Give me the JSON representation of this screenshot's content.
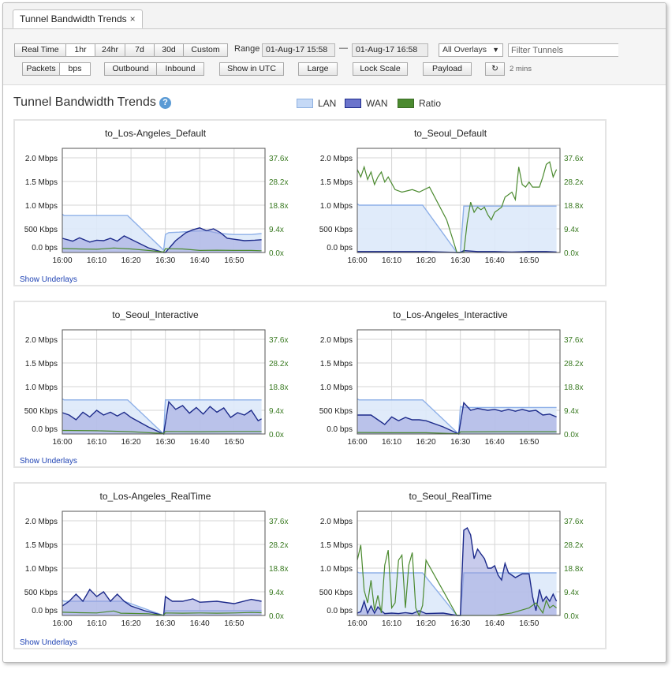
{
  "tab": {
    "title": "Tunnel Bandwidth Trends",
    "close": "×"
  },
  "toolbar": {
    "time_buttons": [
      "Real Time",
      "1hr",
      "24hr",
      "7d",
      "30d",
      "Custom"
    ],
    "active_time": "1hr",
    "range_label": "Range",
    "range_start": "01-Aug-17 15:58",
    "range_sep": "—",
    "range_end": "01-Aug-17 16:58",
    "overlay_select": "All Overlays",
    "filter_placeholder": "Filter Tunnels",
    "unit_buttons": [
      "Packets",
      "bps"
    ],
    "active_unit": "bps",
    "direction_buttons": [
      "Outbound",
      "Inbound"
    ],
    "utc_button": "Show in UTC",
    "large_button": "Large",
    "lockscale_button": "Lock Scale",
    "payload_button": "Payload",
    "refresh_icon": "refresh-icon",
    "refresh_glyph": "↻",
    "refresh_interval": "2 mins"
  },
  "page": {
    "title": "Tunnel Bandwidth Trends",
    "help_glyph": "?",
    "legend": [
      {
        "label": "LAN",
        "color": "#c5d9f6",
        "border": "#8eb0e0"
      },
      {
        "label": "WAN",
        "color": "#6b74cc",
        "border": "#1c2a8a"
      },
      {
        "label": "Ratio",
        "color": "#4b8a2f",
        "border": "#3a6b24"
      }
    ],
    "show_underlays": "Show Underlays"
  },
  "chart_axes": {
    "y_ticks": [
      "2.0 Mbps",
      "1.5 Mbps",
      "1.0 Mbps",
      "500 Kbps",
      "0.0 bps"
    ],
    "y_values_mbps": [
      2.0,
      1.5,
      1.0,
      0.5,
      0.0
    ],
    "y2_ticks": [
      "37.6x",
      "28.2x",
      "18.8x",
      "9.4x",
      "0.0x"
    ],
    "x_ticks": [
      "16:00",
      "16:10",
      "16:20",
      "16:30",
      "16:40",
      "16:50"
    ],
    "x_minutes": [
      0,
      10,
      20,
      30,
      40,
      50
    ]
  },
  "chart_data": [
    {
      "type": "area",
      "title": "to_Los-Angeles_Default",
      "ylim": [
        0,
        2.2
      ],
      "y2lim": [
        0,
        41.4
      ],
      "xlim": [
        0,
        59
      ],
      "series": [
        {
          "name": "LAN",
          "x": [
            0,
            0.5,
            19,
            29.5,
            30,
            31,
            34,
            38,
            42,
            46,
            50,
            55,
            58
          ],
          "y": [
            0.81,
            0.78,
            0.78,
            0.05,
            0.38,
            0.42,
            0.43,
            0.45,
            0.46,
            0.4,
            0.38,
            0.38,
            0.4
          ]
        },
        {
          "name": "WAN",
          "x": [
            0,
            3,
            5,
            8,
            10,
            12,
            14,
            16,
            18,
            20,
            25,
            29.5,
            30,
            33,
            36,
            38,
            40,
            42,
            44,
            46,
            48,
            50,
            53,
            56,
            58
          ],
          "y": [
            0.3,
            0.24,
            0.31,
            0.22,
            0.26,
            0.25,
            0.3,
            0.24,
            0.35,
            0.28,
            0.1,
            0.0,
            0.0,
            0.25,
            0.42,
            0.48,
            0.52,
            0.46,
            0.5,
            0.42,
            0.3,
            0.28,
            0.25,
            0.26,
            0.27
          ]
        },
        {
          "name": "Ratio",
          "x": [
            0,
            5,
            10,
            15,
            20,
            25,
            29.5,
            30,
            35,
            40,
            45,
            50,
            55,
            58
          ],
          "y": [
            1.6,
            1.4,
            1.3,
            1.8,
            1.4,
            0.8,
            0.2,
            1.5,
            1.4,
            0.8,
            0.9,
            0.8,
            0.8,
            0.7
          ]
        }
      ]
    },
    {
      "type": "area",
      "title": "to_Seoul_Default",
      "ylim": [
        0,
        2.2
      ],
      "y2lim": [
        0,
        41.4
      ],
      "xlim": [
        0,
        59
      ],
      "series": [
        {
          "name": "LAN",
          "x": [
            0,
            0.5,
            19,
            29,
            30,
            31,
            58
          ],
          "y": [
            1.03,
            1.0,
            1.0,
            0.0,
            0.0,
            0.98,
            0.98
          ]
        },
        {
          "name": "WAN",
          "x": [
            0,
            10,
            20,
            29,
            30,
            31,
            35,
            40,
            45,
            50,
            55,
            58
          ],
          "y": [
            0.02,
            0.02,
            0.02,
            0.0,
            0.0,
            0.04,
            0.02,
            0.02,
            0.01,
            0.02,
            0.02,
            0.01
          ]
        },
        {
          "name": "Ratio",
          "x": [
            0,
            1,
            2,
            3,
            4,
            5,
            6,
            7,
            8,
            9,
            11,
            13,
            16,
            18,
            21,
            26,
            29,
            30,
            31,
            32,
            33,
            34,
            35,
            36,
            37,
            38,
            39,
            40,
            41,
            42,
            43,
            45,
            46,
            47,
            48,
            49,
            50,
            51,
            53,
            54,
            55,
            56,
            57,
            58
          ],
          "y": [
            33,
            30,
            34,
            29,
            32,
            27,
            30,
            32,
            28,
            30,
            25,
            24,
            25,
            24,
            26,
            13,
            0,
            0,
            0,
            12,
            20,
            16,
            18,
            17,
            18,
            15,
            13,
            16,
            17,
            18,
            22,
            24,
            21,
            34,
            27,
            26,
            28,
            26,
            26,
            30,
            35,
            36,
            30,
            33
          ]
        }
      ]
    },
    {
      "type": "area",
      "title": "to_Seoul_Interactive",
      "ylim": [
        0,
        2.2
      ],
      "y2lim": [
        0,
        41.4
      ],
      "xlim": [
        0,
        59
      ],
      "series": [
        {
          "name": "LAN",
          "x": [
            0,
            0.5,
            19,
            29.5,
            30,
            58
          ],
          "y": [
            0.74,
            0.72,
            0.72,
            0.0,
            0.72,
            0.72
          ]
        },
        {
          "name": "WAN",
          "x": [
            0,
            2,
            4,
            6,
            8,
            10,
            12,
            14,
            16,
            18,
            20,
            25,
            29.5,
            31,
            33,
            35,
            37,
            39,
            41,
            43,
            45,
            47,
            49,
            51,
            53,
            55,
            57,
            58
          ],
          "y": [
            0.45,
            0.4,
            0.3,
            0.46,
            0.36,
            0.5,
            0.4,
            0.46,
            0.38,
            0.46,
            0.35,
            0.15,
            0.0,
            0.68,
            0.52,
            0.6,
            0.44,
            0.56,
            0.42,
            0.58,
            0.46,
            0.55,
            0.35,
            0.45,
            0.4,
            0.5,
            0.28,
            0.32
          ]
        },
        {
          "name": "Ratio",
          "x": [
            0,
            10,
            20,
            29.5,
            30,
            40,
            50,
            58
          ],
          "y": [
            1.4,
            1.3,
            0.9,
            0.2,
            1.0,
            0.9,
            1.0,
            1.0
          ]
        }
      ]
    },
    {
      "type": "area",
      "title": "to_Los-Angeles_Interactive",
      "ylim": [
        0,
        2.2
      ],
      "y2lim": [
        0,
        41.4
      ],
      "xlim": [
        0,
        59
      ],
      "series": [
        {
          "name": "LAN",
          "x": [
            0,
            0.5,
            19,
            29.5,
            30,
            31,
            58
          ],
          "y": [
            0.74,
            0.72,
            0.72,
            0.0,
            0.58,
            0.56,
            0.56
          ]
        },
        {
          "name": "WAN",
          "x": [
            0,
            4,
            6,
            8,
            10,
            12,
            14,
            16,
            18,
            20,
            25,
            29.5,
            31,
            33,
            35,
            38,
            40,
            42,
            44,
            46,
            48,
            50,
            52,
            54,
            56,
            58
          ],
          "y": [
            0.4,
            0.4,
            0.3,
            0.2,
            0.36,
            0.28,
            0.35,
            0.3,
            0.3,
            0.28,
            0.15,
            0.0,
            0.66,
            0.5,
            0.54,
            0.5,
            0.52,
            0.48,
            0.52,
            0.48,
            0.52,
            0.48,
            0.5,
            0.4,
            0.42,
            0.36
          ]
        },
        {
          "name": "Ratio",
          "x": [
            0,
            10,
            20,
            29.5,
            30,
            40,
            50,
            58
          ],
          "y": [
            0.6,
            0.5,
            0.5,
            0.1,
            0.8,
            0.9,
            0.9,
            0.9
          ]
        }
      ]
    },
    {
      "type": "area",
      "title": "to_Los-Angeles_RealTime",
      "ylim": [
        0,
        2.2
      ],
      "y2lim": [
        0,
        41.4
      ],
      "xlim": [
        0,
        59
      ],
      "series": [
        {
          "name": "LAN",
          "x": [
            0,
            0.5,
            18,
            29.5,
            30,
            58
          ],
          "y": [
            0.32,
            0.3,
            0.3,
            0.0,
            0.1,
            0.1
          ]
        },
        {
          "name": "WAN",
          "x": [
            0,
            2,
            4,
            6,
            8,
            10,
            12,
            14,
            16,
            18,
            20,
            24,
            29.5,
            30,
            32,
            35,
            38,
            40,
            45,
            50,
            55,
            58
          ],
          "y": [
            0.2,
            0.3,
            0.45,
            0.3,
            0.55,
            0.4,
            0.5,
            0.3,
            0.45,
            0.3,
            0.2,
            0.1,
            0.0,
            0.4,
            0.3,
            0.3,
            0.35,
            0.28,
            0.3,
            0.25,
            0.34,
            0.3
          ]
        },
        {
          "name": "Ratio",
          "x": [
            0,
            5,
            10,
            15,
            17,
            20,
            25,
            29.5,
            30,
            35,
            40,
            45,
            50,
            55,
            58
          ],
          "y": [
            1.3,
            1.1,
            1.0,
            1.8,
            0.9,
            0.8,
            0.7,
            0.1,
            1.0,
            0.9,
            1.0,
            0.9,
            1.0,
            1.2,
            1.1
          ]
        }
      ]
    },
    {
      "type": "area",
      "title": "to_Seoul_RealTime",
      "ylim": [
        0,
        2.2
      ],
      "y2lim": [
        0,
        41.4
      ],
      "xlim": [
        0,
        59
      ],
      "series": [
        {
          "name": "LAN",
          "x": [
            0,
            0.5,
            19,
            29,
            30,
            31,
            58
          ],
          "y": [
            0.92,
            0.9,
            0.9,
            0.0,
            0.0,
            0.9,
            0.9
          ]
        },
        {
          "name": "WAN",
          "x": [
            0,
            1,
            2,
            3,
            4,
            5,
            6,
            7,
            8,
            10,
            12,
            14,
            16,
            18,
            20,
            25,
            29,
            30,
            31,
            32,
            33,
            34,
            35,
            36,
            37,
            38,
            39,
            40,
            41,
            42,
            43,
            44,
            46,
            48,
            50,
            51,
            52,
            53,
            54,
            55,
            56,
            57,
            58
          ],
          "y": [
            0.05,
            0.08,
            0.3,
            0.05,
            0.2,
            0.05,
            0.18,
            0.1,
            0.04,
            0.05,
            0.04,
            0.06,
            0.04,
            0.1,
            0.04,
            0.05,
            0.0,
            0.0,
            1.8,
            1.85,
            1.7,
            1.2,
            1.4,
            1.3,
            1.2,
            1.0,
            1.0,
            1.05,
            0.85,
            0.75,
            1.1,
            0.9,
            0.8,
            0.88,
            0.88,
            0.4,
            0.1,
            0.55,
            0.3,
            0.4,
            0.3,
            0.45,
            0.3
          ]
        },
        {
          "name": "Ratio",
          "x": [
            0,
            1,
            2,
            3,
            4,
            5,
            6,
            7,
            8,
            9,
            10,
            11,
            12,
            13,
            14,
            15,
            16,
            17,
            18,
            19,
            20,
            29,
            30,
            40,
            45,
            50,
            52,
            54,
            55,
            56,
            57,
            58
          ],
          "y": [
            22,
            28,
            10,
            5,
            14,
            2,
            8,
            1,
            20,
            26,
            3,
            5,
            22,
            24,
            3,
            20,
            25,
            3,
            0,
            4,
            22,
            0,
            0,
            0,
            1,
            3,
            5,
            1,
            6,
            3,
            4,
            3
          ]
        }
      ]
    }
  ]
}
